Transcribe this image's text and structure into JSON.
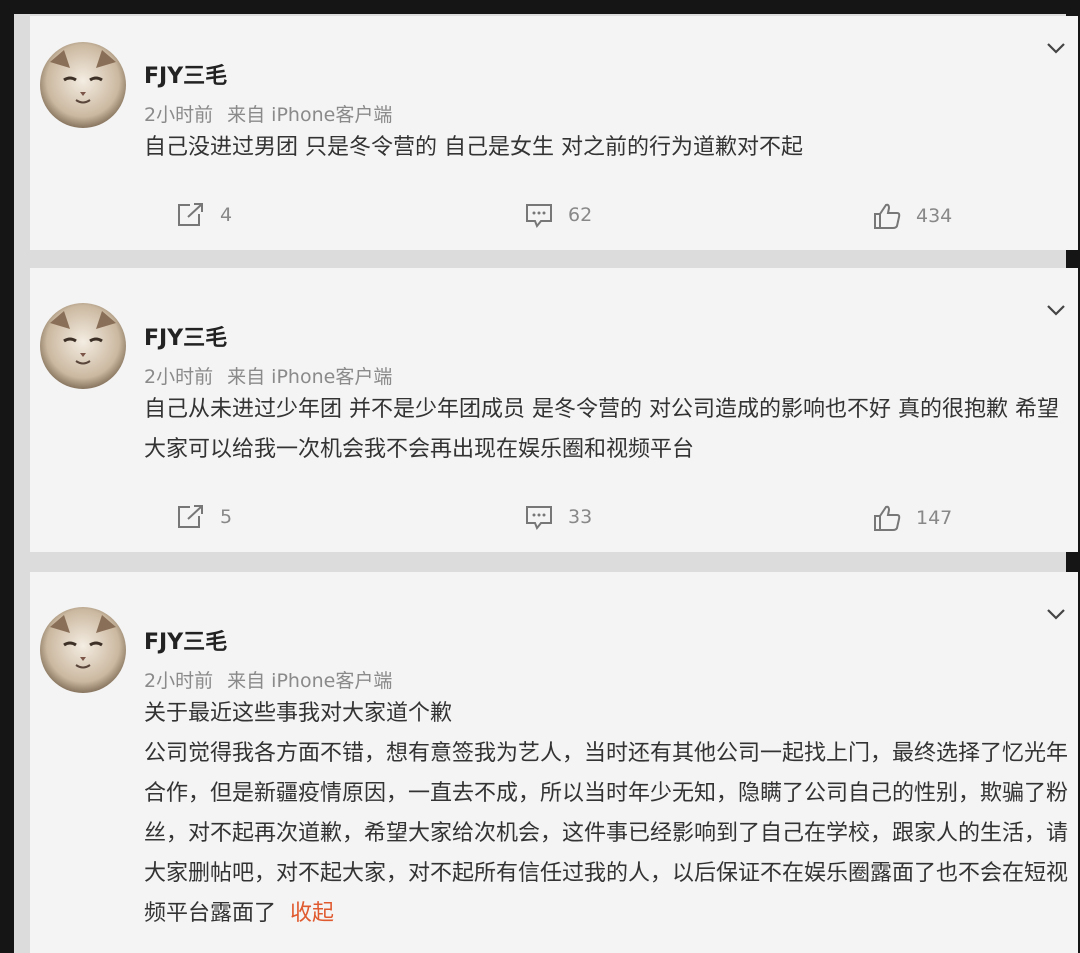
{
  "posts": [
    {
      "username": "FJY三毛",
      "time": "2小时前",
      "source": "来自 iPhone客户端",
      "content": [
        "自己没进过男团 只是冬令营的 自己是女生 对之前的行为道歉对不起"
      ],
      "share_count": "4",
      "comment_count": "62",
      "like_count": "434"
    },
    {
      "username": "FJY三毛",
      "time": "2小时前",
      "source": "来自 iPhone客户端",
      "content": [
        "自己从未进过少年团 并不是少年团成员 是冬令营的 对公司造成的影响也不好 真的很抱歉 希望大家可以给我一次机会我不会再出现在娱乐圈和视频平台"
      ],
      "share_count": "5",
      "comment_count": "33",
      "like_count": "147"
    },
    {
      "username": "FJY三毛",
      "time": "2小时前",
      "source": "来自 iPhone客户端",
      "content": [
        "关于最近这些事我对大家道个歉",
        "公司觉得我各方面不错，想有意签我为艺人，当时还有其他公司一起找上门，最终选择了忆光年合作，但是新疆疫情原因，一直去不成，所以当时年少无知，隐瞒了公司自己的性别，欺骗了粉丝，对不起再次道歉，希望大家给次机会，这件事已经影响到了自己在学校，跟家人的生活，请大家删帖吧，对不起大家，对不起所有信任过我的人，以后保证不在娱乐圈露面了也不会在短视频平台露面了"
      ],
      "collapse_label": "收起"
    }
  ],
  "icons": {
    "share": "share-icon",
    "comment": "comment-icon",
    "like": "like-icon",
    "menu": "chevron-down-icon",
    "avatar": "cat-avatar"
  },
  "colors": {
    "accent": "#e05a2f",
    "frame": "#151515",
    "card": "#f4f4f4",
    "separator": "#dcdcdc"
  }
}
